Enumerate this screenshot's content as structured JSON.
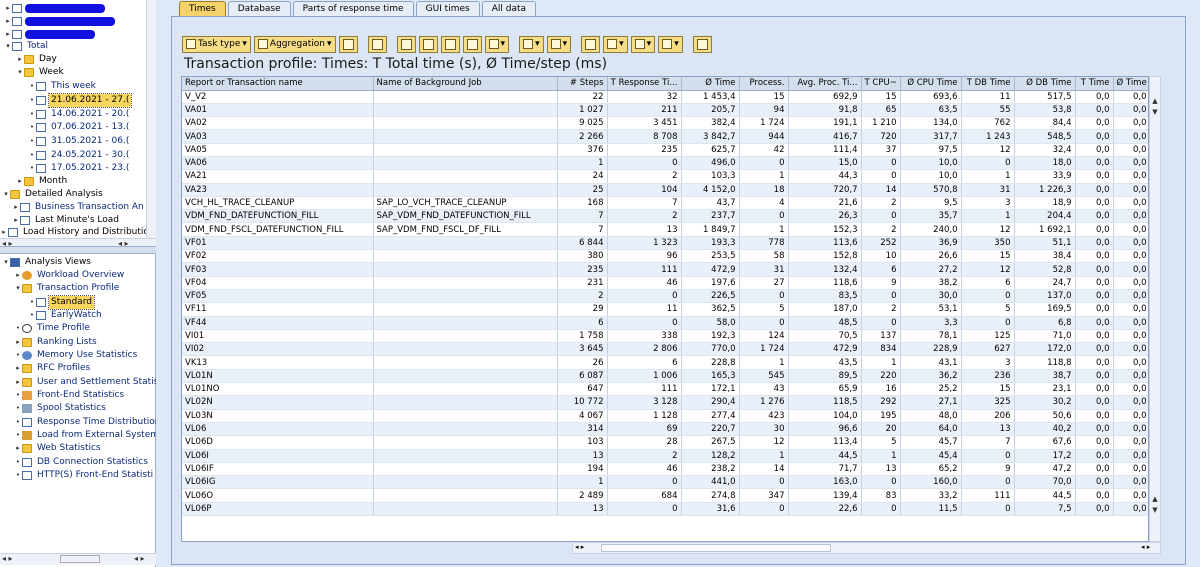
{
  "nav_tree": {
    "top_items": [
      {
        "label": "Total",
        "expanded": true
      },
      {
        "label": "Day",
        "expanded": false
      },
      {
        "label": "Week",
        "expanded": true
      },
      {
        "label": "This week"
      },
      {
        "label": "21.06.2021 - 27.("
      },
      {
        "label": "14.06.2021 - 20.("
      },
      {
        "label": "07.06.2021 - 13.("
      },
      {
        "label": "31.05.2021 - 06.("
      },
      {
        "label": "24.05.2021 - 30.("
      },
      {
        "label": "17.05.2021 - 23.("
      },
      {
        "label": "Month"
      }
    ],
    "detailed": {
      "title": "Detailed Analysis",
      "items": [
        "Business Transaction An",
        "Last Minute's Load",
        "Load History and Distributio"
      ]
    },
    "analysis_views": {
      "title": "Analysis Views",
      "items": [
        "Workload Overview",
        "Transaction Profile",
        "Standard",
        "EarlyWatch",
        "Time Profile",
        "Ranking Lists",
        "Memory Use Statistics",
        "RFC Profiles",
        "User and Settlement Statis",
        "Front-End Statistics",
        "Spool Statistics",
        "Response Time Distribution",
        "Load from External System",
        "Web Statistics",
        "DB Connection Statistics",
        "HTTP(S) Front-End Statisti"
      ]
    }
  },
  "tabs": [
    "Times",
    "Database",
    "Parts of response time",
    "GUI times",
    "All data"
  ],
  "toolbar": {
    "task_type": "Task type",
    "aggregation": "Aggregation"
  },
  "title": "Transaction profile: Times: T Total time (s), Ø Time/step (ms)",
  "columns": [
    "Report or Transaction name",
    "Name of Background Job",
    "# Steps",
    "T Response Ti...",
    "Ø Time",
    "Process.",
    "Avg. Proc. Ti...",
    "T CPU~",
    "Ø CPU Time",
    "T DB Time",
    "Ø DB Time",
    "T Time",
    "Ø Time"
  ],
  "rows": [
    [
      "V_V2",
      "",
      "22",
      "32",
      "1 453,4",
      "15",
      "692,9",
      "15",
      "693,6",
      "11",
      "517,5",
      "0,0",
      "0,0"
    ],
    [
      "VA01",
      "",
      "1 027",
      "211",
      "205,7",
      "94",
      "91,8",
      "65",
      "63,5",
      "55",
      "53,8",
      "0,0",
      "0,0"
    ],
    [
      "VA02",
      "",
      "9 025",
      "3 451",
      "382,4",
      "1 724",
      "191,1",
      "1 210",
      "134,0",
      "762",
      "84,4",
      "0,0",
      "0,0"
    ],
    [
      "VA03",
      "",
      "2 266",
      "8 708",
      "3 842,7",
      "944",
      "416,7",
      "720",
      "317,7",
      "1 243",
      "548,5",
      "0,0",
      "0,0"
    ],
    [
      "VA05",
      "",
      "376",
      "235",
      "625,7",
      "42",
      "111,4",
      "37",
      "97,5",
      "12",
      "32,4",
      "0,0",
      "0,0"
    ],
    [
      "VA06",
      "",
      "1",
      "0",
      "496,0",
      "0",
      "15,0",
      "0",
      "10,0",
      "0",
      "18,0",
      "0,0",
      "0,0"
    ],
    [
      "VA21",
      "",
      "24",
      "2",
      "103,3",
      "1",
      "44,3",
      "0",
      "10,0",
      "1",
      "33,9",
      "0,0",
      "0,0"
    ],
    [
      "VA23",
      "",
      "25",
      "104",
      "4 152,0",
      "18",
      "720,7",
      "14",
      "570,8",
      "31",
      "1 226,3",
      "0,0",
      "0,0"
    ],
    [
      "VCH_HL_TRACE_CLEANUP",
      "SAP_LO_VCH_TRACE_CLEANUP",
      "168",
      "7",
      "43,7",
      "4",
      "21,6",
      "2",
      "9,5",
      "3",
      "18,9",
      "0,0",
      "0,0"
    ],
    [
      "VDM_FND_DATEFUNCTION_FILL",
      "SAP_VDM_FND_DATEFUNCTION_FILL",
      "7",
      "2",
      "237,7",
      "0",
      "26,3",
      "0",
      "35,7",
      "1",
      "204,4",
      "0,0",
      "0,0"
    ],
    [
      "VDM_FND_FSCL_DATEFUNCTION_FILL",
      "SAP_VDM_FND_FSCL_DF_FILL",
      "7",
      "13",
      "1 849,7",
      "1",
      "152,3",
      "2",
      "240,0",
      "12",
      "1 692,1",
      "0,0",
      "0,0"
    ],
    [
      "VF01",
      "",
      "6 844",
      "1 323",
      "193,3",
      "778",
      "113,6",
      "252",
      "36,9",
      "350",
      "51,1",
      "0,0",
      "0,0"
    ],
    [
      "VF02",
      "",
      "380",
      "96",
      "253,5",
      "58",
      "152,8",
      "10",
      "26,6",
      "15",
      "38,4",
      "0,0",
      "0,0"
    ],
    [
      "VF03",
      "",
      "235",
      "111",
      "472,9",
      "31",
      "132,4",
      "6",
      "27,2",
      "12",
      "52,8",
      "0,0",
      "0,0"
    ],
    [
      "VF04",
      "",
      "231",
      "46",
      "197,6",
      "27",
      "118,6",
      "9",
      "38,2",
      "6",
      "24,7",
      "0,0",
      "0,0"
    ],
    [
      "VF05",
      "",
      "2",
      "0",
      "226,5",
      "0",
      "83,5",
      "0",
      "30,0",
      "0",
      "137,0",
      "0,0",
      "0,0"
    ],
    [
      "VF11",
      "",
      "29",
      "11",
      "362,5",
      "5",
      "187,0",
      "2",
      "53,1",
      "5",
      "169,5",
      "0,0",
      "0,0"
    ],
    [
      "VF44",
      "",
      "6",
      "0",
      "58,0",
      "0",
      "48,5",
      "0",
      "3,3",
      "0",
      "6,8",
      "0,0",
      "0,0"
    ],
    [
      "VI01",
      "",
      "1 758",
      "338",
      "192,3",
      "124",
      "70,5",
      "137",
      "78,1",
      "125",
      "71,0",
      "0,0",
      "0,0"
    ],
    [
      "VI02",
      "",
      "3 645",
      "2 806",
      "770,0",
      "1 724",
      "472,9",
      "834",
      "228,9",
      "627",
      "172,0",
      "0,0",
      "0,0"
    ],
    [
      "VK13",
      "",
      "26",
      "6",
      "228,8",
      "1",
      "43,5",
      "1",
      "43,1",
      "3",
      "118,8",
      "0,0",
      "0,0"
    ],
    [
      "VL01N",
      "",
      "6 087",
      "1 006",
      "165,3",
      "545",
      "89,5",
      "220",
      "36,2",
      "236",
      "38,7",
      "0,0",
      "0,0"
    ],
    [
      "VL01NO",
      "",
      "647",
      "111",
      "172,1",
      "43",
      "65,9",
      "16",
      "25,2",
      "15",
      "23,1",
      "0,0",
      "0,0"
    ],
    [
      "VL02N",
      "",
      "10 772",
      "3 128",
      "290,4",
      "1 276",
      "118,5",
      "292",
      "27,1",
      "325",
      "30,2",
      "0,0",
      "0,0"
    ],
    [
      "VL03N",
      "",
      "4 067",
      "1 128",
      "277,4",
      "423",
      "104,0",
      "195",
      "48,0",
      "206",
      "50,6",
      "0,0",
      "0,0"
    ],
    [
      "VL06",
      "",
      "314",
      "69",
      "220,7",
      "30",
      "96,6",
      "20",
      "64,0",
      "13",
      "40,2",
      "0,0",
      "0,0"
    ],
    [
      "VL06D",
      "",
      "103",
      "28",
      "267,5",
      "12",
      "113,4",
      "5",
      "45,7",
      "7",
      "67,6",
      "0,0",
      "0,0"
    ],
    [
      "VL06I",
      "",
      "13",
      "2",
      "128,2",
      "1",
      "44,5",
      "1",
      "45,4",
      "0",
      "17,2",
      "0,0",
      "0,0"
    ],
    [
      "VL06IF",
      "",
      "194",
      "46",
      "238,2",
      "14",
      "71,7",
      "13",
      "65,2",
      "9",
      "47,2",
      "0,0",
      "0,0"
    ],
    [
      "VL06IG",
      "",
      "1",
      "0",
      "441,0",
      "0",
      "163,0",
      "0",
      "160,0",
      "0",
      "70,0",
      "0,0",
      "0,0"
    ],
    [
      "VL06O",
      "",
      "2 489",
      "684",
      "274,8",
      "347",
      "139,4",
      "83",
      "33,2",
      "111",
      "44,5",
      "0,0",
      "0,0"
    ],
    [
      "VL06P",
      "",
      "13",
      "0",
      "31,6",
      "0",
      "22,6",
      "0",
      "11,5",
      "0",
      "7,5",
      "0,0",
      "0,0"
    ]
  ],
  "colors": {
    "selected": "#f8d65e",
    "row_alt": "#e9f0fa",
    "header": "#d4dfee",
    "toolbar_button": "#f6dc84"
  }
}
